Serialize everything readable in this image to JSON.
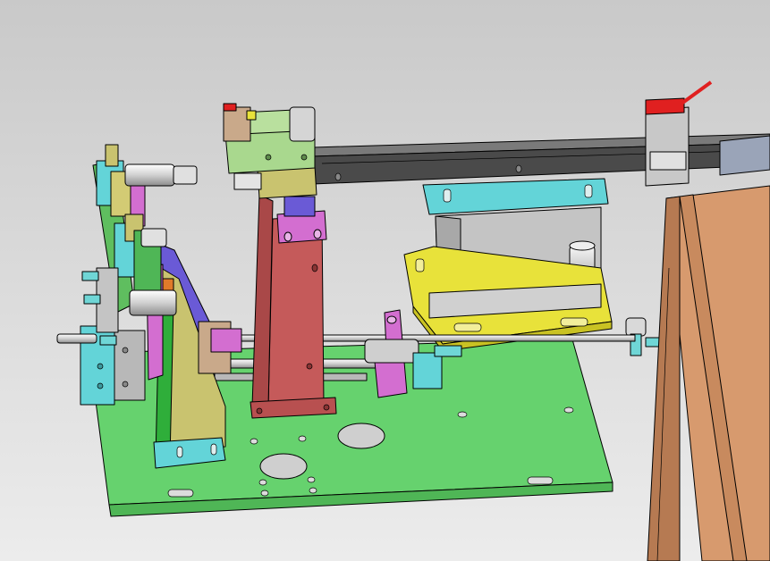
{
  "colors": {
    "background_top": "#c9c9c9",
    "background_bottom": "#ececec",
    "base_plate": "#66d26e",
    "base_plate_edge": "#4fb656",
    "rail": "#4a4a4a",
    "rail_top": "#7a7a7a",
    "pillar": "#c55a5a",
    "pillar_side": "#a94848",
    "block_lightgreen": "#a9d88e",
    "block_khaki": "#c9c36f",
    "block_cyan": "#63d4d8",
    "block_yellow": "#e8e23a",
    "block_gray": "#b8b8b8",
    "block_magenta": "#d36ed0",
    "block_violet": "#6a5ad6",
    "block_green": "#2fae3a",
    "block_tan": "#c9a98a",
    "block_orange": "#e07a2a",
    "table_top": "#d79a6e",
    "table_side": "#b67a52",
    "handle_red": "#e02020",
    "cylinder_white": "#eeeeee"
  }
}
